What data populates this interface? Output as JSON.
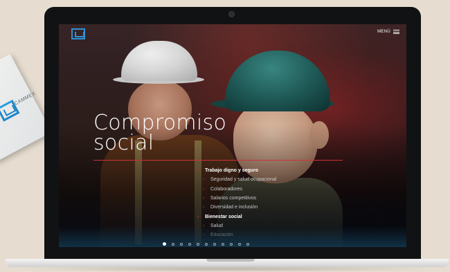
{
  "brochure": {
    "text": "CAMMEX"
  },
  "header": {
    "menu_label": "MENÚ"
  },
  "hero": {
    "title_line1": "Compromiso",
    "title_line2": "social"
  },
  "menu": {
    "items": [
      {
        "label": "Trabajo digno y seguro",
        "type": "section"
      },
      {
        "label": "Seguridad y salud ocupacional",
        "type": "sub"
      },
      {
        "label": "Colaboradores",
        "type": "sub"
      },
      {
        "label": "Salarios competitivos",
        "type": "sub"
      },
      {
        "label": "Diversidad e inclusión",
        "type": "sub"
      },
      {
        "label": "Bienestar social",
        "type": "section"
      },
      {
        "label": "Salud",
        "type": "sub"
      },
      {
        "label": "Educación",
        "type": "sub"
      }
    ]
  },
  "pagination": {
    "total": 11,
    "active_index": 0
  }
}
